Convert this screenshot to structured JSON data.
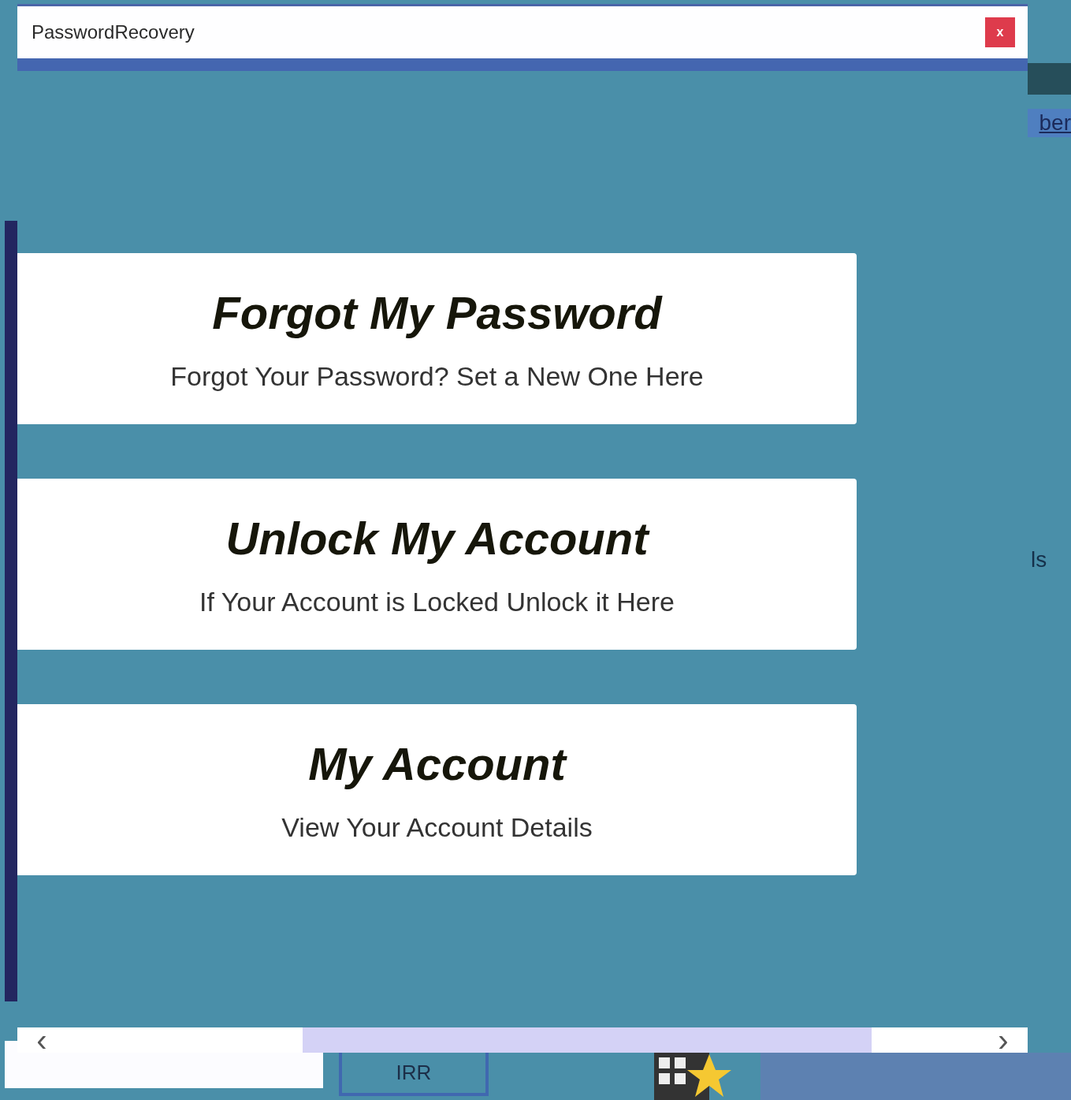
{
  "window": {
    "title": "PasswordRecovery",
    "close_label": "x"
  },
  "options": [
    {
      "title": "Forgot My Password",
      "subtitle": "Forgot Your Password? Set a New One Here"
    },
    {
      "title": "Unlock My Account",
      "subtitle": "If Your Account is Locked Unlock it Here"
    },
    {
      "title": "My Account",
      "subtitle": "View Your Account Details"
    }
  ],
  "scrollbar": {
    "left_arrow": "‹",
    "right_arrow": "›"
  },
  "background_app": {
    "link_fragment": "ber",
    "text_fragment": "ls",
    "button_label": "IRR"
  }
}
